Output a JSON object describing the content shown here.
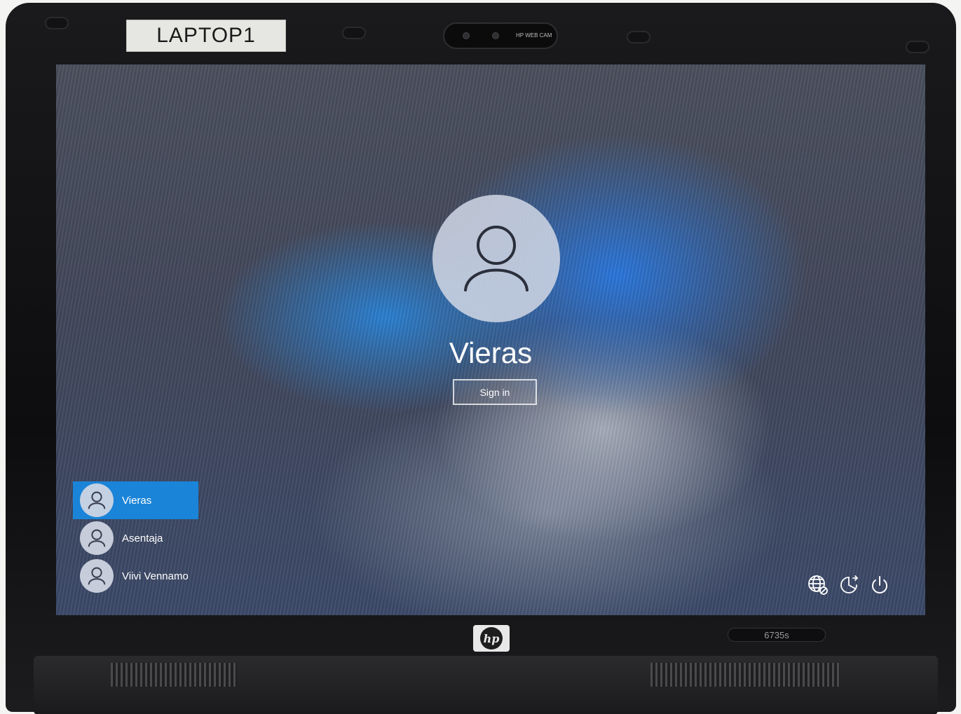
{
  "device": {
    "asset_label": "LAPTOP1",
    "webcam_label": "HP WEB CAM",
    "brand_logo": "hp",
    "model": "6735s"
  },
  "lock_screen": {
    "current_user": "Vieras",
    "sign_in_label": "Sign in",
    "avatar_icon": "user-icon",
    "users": [
      {
        "name": "Vieras",
        "selected": true
      },
      {
        "name": "Asentaja",
        "selected": false
      },
      {
        "name": "Viivi Vennamo",
        "selected": false
      }
    ],
    "corner_icons": [
      "network-icon",
      "accessibility-icon",
      "power-icon"
    ]
  },
  "colors": {
    "selection": "#1a84d8",
    "text": "#ffffff"
  }
}
